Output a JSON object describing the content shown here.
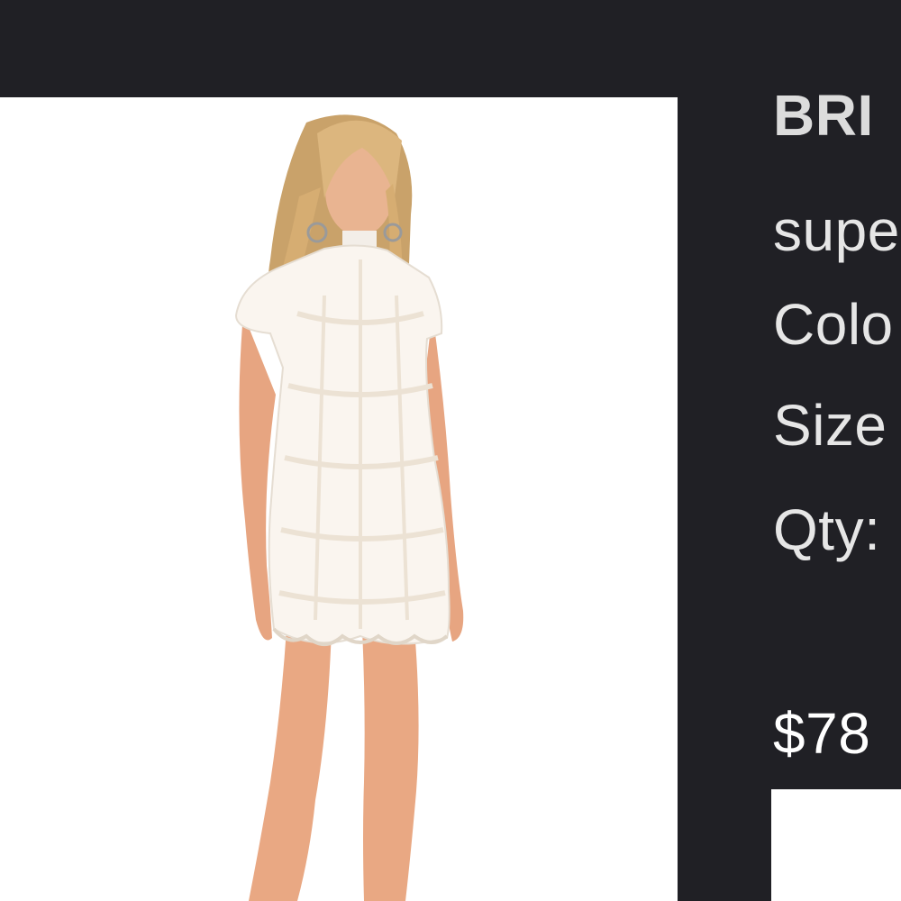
{
  "product": {
    "name": "BRI",
    "brand": "supe",
    "color_label": "Colo",
    "size_label": "Size",
    "qty_label": "Qty:",
    "price": "$78"
  },
  "colors": {
    "background": "#202025",
    "image_background": "#ffffff",
    "text": "#e6e6e6",
    "dress": "#faf5ef",
    "skin": "#e7a581",
    "hair": "#d8b27a"
  }
}
